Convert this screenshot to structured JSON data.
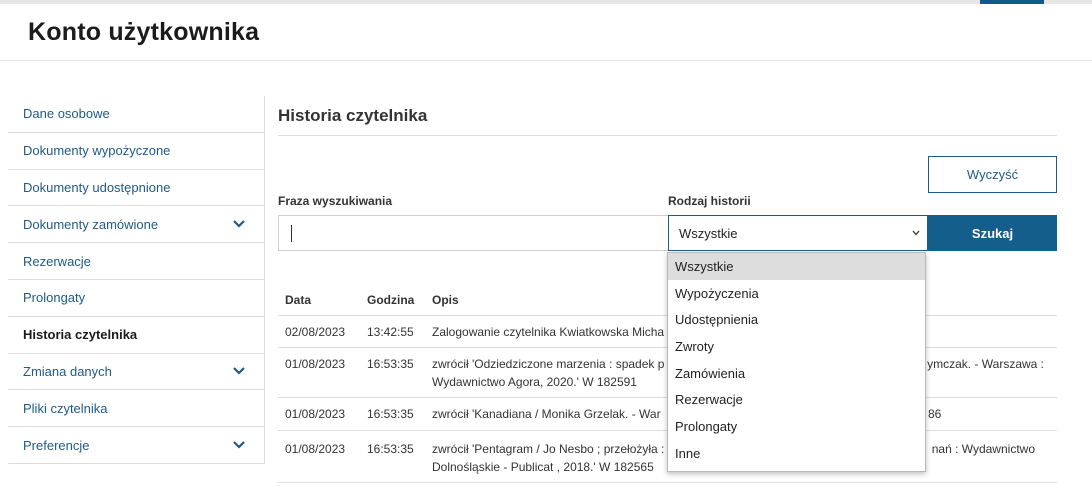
{
  "header": {
    "title": "Konto użytkownika"
  },
  "sidebar": {
    "items": [
      {
        "label": "Dane osobowe"
      },
      {
        "label": "Dokumenty wypożyczone"
      },
      {
        "label": "Dokumenty udostępnione"
      },
      {
        "label": "Dokumenty zamówione",
        "chevron": "chevron-down-icon"
      },
      {
        "label": "Rezerwacje"
      },
      {
        "label": "Prolongaty"
      },
      {
        "label": "Historia czytelnika",
        "active": true
      },
      {
        "label": "Zmiana danych",
        "chevron": "chevron-down-icon"
      },
      {
        "label": "Pliki czytelnika"
      },
      {
        "label": "Preferencje",
        "chevron": "chevron-down-icon"
      }
    ]
  },
  "main": {
    "title": "Historia czytelnika",
    "clear_label": "Wyczyść",
    "phrase_label": "Fraza wyszukiwania",
    "phrase_value": "",
    "type_label": "Rodzaj historii",
    "type_selected": "Wszystkie",
    "search_label": "Szukaj"
  },
  "table": {
    "headers": {
      "date": "Data",
      "time": "Godzina",
      "desc": "Opis"
    },
    "rows": [
      {
        "date": "02/08/2023",
        "time": "13:42:55",
        "desc_lines": [
          "Zalogowanie czytelnika Kwiatkowska Micha"
        ]
      },
      {
        "date": "01/08/2023",
        "time": "16:53:35",
        "desc_lines": [
          "zwrócił 'Odziedziczone marzenia : spadek p",
          "Wydawnictwo Agora, 2020.' W 182591"
        ],
        "desc_right": "ymczak. - Warszawa :"
      },
      {
        "date": "01/08/2023",
        "time": "16:53:35",
        "desc_lines": [
          "zwrócił 'Kanadiana / Monika Grzelak. - War"
        ],
        "desc_right": "86"
      },
      {
        "date": "01/08/2023",
        "time": "16:53:35",
        "desc_lines": [
          "zwrócił 'Pentagram / Jo Nesbo ; przełożyła :",
          "Dolnośląskie - Publicat , 2018.' W 182565"
        ],
        "desc_right": "nań : Wydawnictwo"
      }
    ]
  },
  "dropdown": {
    "options": [
      "Wszystkie",
      "Wypożyczenia",
      "Udostępnienia",
      "Zwroty",
      "Zamówienia",
      "Rezerwacje",
      "Prolongaty",
      "Inne"
    ],
    "selected_index": 0
  },
  "colors": {
    "accent": "#145e8c",
    "link": "#1f5a88",
    "selected_option_bg": "#dddddd"
  }
}
